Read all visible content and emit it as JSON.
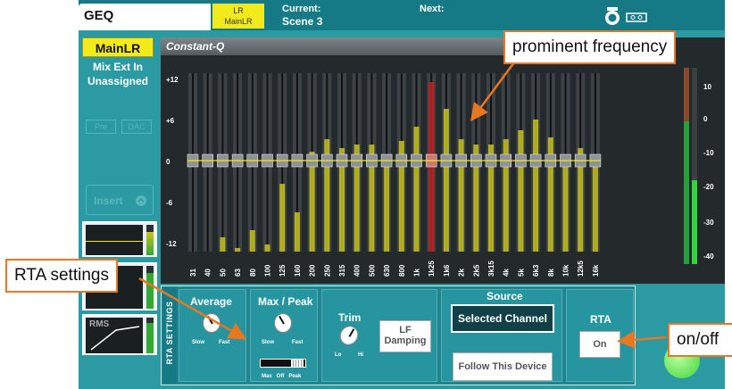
{
  "header": {
    "title": "GEQ",
    "mix_badge_line1": "LR",
    "mix_badge_line2": "MainLR",
    "current_label": "Current:",
    "current_value": "Scene 3",
    "next_label": "Next:"
  },
  "sidebar": {
    "mix_name": "MainLR",
    "mix_ext": "Mix Ext In",
    "mix_assign": "Unassigned",
    "ghost_btn_1": "Pre",
    "ghost_btn_2": "DAC",
    "insert_label": "Insert",
    "rms_label": "RMS"
  },
  "geq": {
    "title": "Constant-Q",
    "gain_scale": [
      "+12",
      "+6",
      "0",
      "-6",
      "-12"
    ],
    "meter_scale": [
      "10",
      "0",
      "-10",
      "-20",
      "-30",
      "-40"
    ],
    "bands": [
      "31",
      "40",
      "50",
      "63",
      "80",
      "100",
      "125",
      "160",
      "200",
      "250",
      "315",
      "400",
      "500",
      "630",
      "800",
      "1k",
      "1k25",
      "1k6",
      "2k",
      "2k5",
      "3k15",
      "4k",
      "5k",
      "6k3",
      "8k",
      "10k",
      "12k5",
      "16k"
    ],
    "rta_levels": [
      0,
      0,
      0.08,
      0.02,
      0.12,
      0.04,
      0.38,
      0.22,
      0.56,
      0.63,
      0.58,
      0.6,
      0.6,
      0.48,
      0.62,
      0.7,
      0.95,
      0.8,
      0.63,
      0.6,
      0.6,
      0.63,
      0.68,
      0.74,
      0.64,
      0.5,
      0.58,
      0.52
    ],
    "prominent_band_index": 16,
    "colors": {
      "bar": "#c9c41f",
      "prominent": "#c8201f",
      "gain_line": "#f3ea1c"
    }
  },
  "rta_settings": {
    "panel_label": "RTA SETTINGS",
    "average": {
      "title": "Average",
      "slow": "Slow",
      "fast": "Fast"
    },
    "max_peak": {
      "title": "Max / Peak",
      "slow": "Slow",
      "fast": "Fast",
      "slider_labels": "Max   Off   Peak"
    },
    "trim": {
      "title": "Trim",
      "lo": "Lo",
      "hi": "Hi"
    },
    "lf_damping": {
      "label_line1": "LF",
      "label_line2": "Damping"
    },
    "source": {
      "title": "Source",
      "selected": "Selected Channel",
      "follow": "Follow This Device"
    },
    "rta": {
      "title": "RTA",
      "button": "On"
    }
  },
  "annotations": {
    "prominent": "prominent frequency",
    "settings": "RTA settings",
    "onoff": "on/off",
    "accent": "#e87722"
  }
}
